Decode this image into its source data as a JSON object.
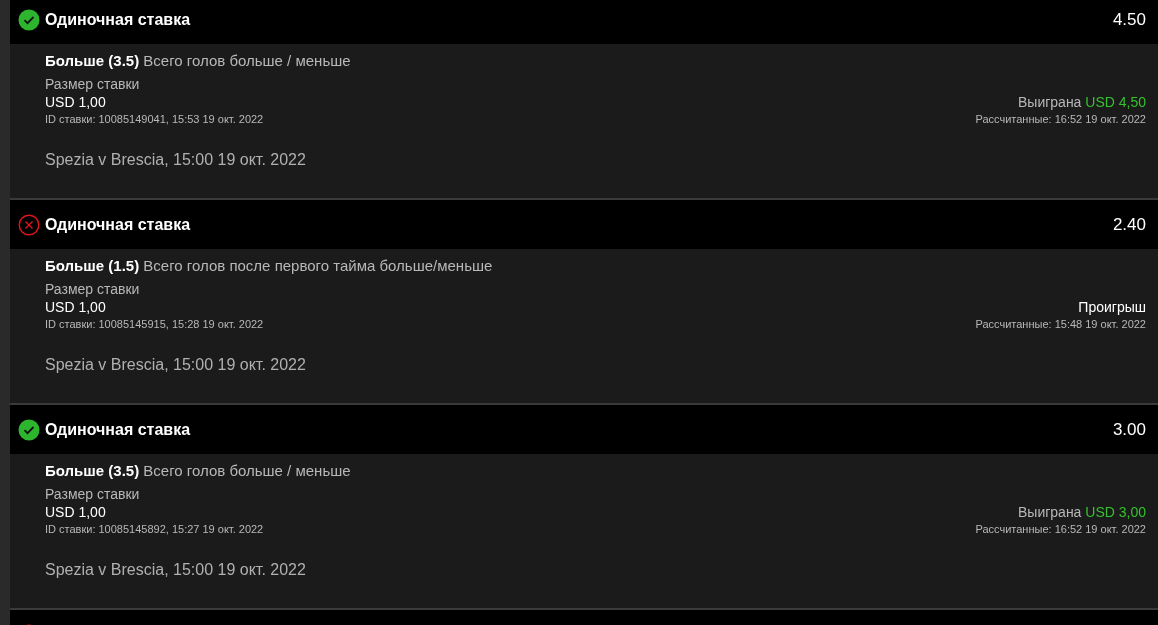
{
  "bets": [
    {
      "won": true,
      "title": "Одиночная ставка",
      "odds": "4.50",
      "selection": "Больше (3.5)",
      "market": "Всего голов больше / меньше",
      "stake_label": "Размер ставки",
      "stake": "USD 1,00",
      "bet_id": "ID ставки: 10085149041, 15:53 19 окт. 2022",
      "result": "Выиграна",
      "payout": "USD 4,50",
      "settled": "Рассчитанные: 16:52 19 окт. 2022",
      "event": "Spezia v Brescia, 15:00 19 окт. 2022"
    },
    {
      "won": false,
      "title": "Одиночная ставка",
      "odds": "2.40",
      "selection": "Больше (1.5)",
      "market": "Всего голов после первого тайма больше/меньше",
      "stake_label": "Размер ставки",
      "stake": "USD 1,00",
      "bet_id": "ID ставки: 10085145915, 15:28 19 окт. 2022",
      "result": "Проигрыш",
      "settled": "Рассчитанные: 15:48 19 окт. 2022",
      "event": "Spezia v Brescia, 15:00 19 окт. 2022"
    },
    {
      "won": true,
      "title": "Одиночная ставка",
      "odds": "3.00",
      "selection": "Больше (3.5)",
      "market": "Всего голов больше / меньше",
      "stake_label": "Размер ставки",
      "stake": "USD 1,00",
      "bet_id": "ID ставки: 10085145892, 15:27 19 окт. 2022",
      "result": "Выиграна",
      "payout": "USD 3,00",
      "settled": "Рассчитанные: 16:52 19 окт. 2022",
      "event": "Spezia v Brescia, 15:00 19 окт. 2022"
    },
    {
      "won": false
    }
  ]
}
